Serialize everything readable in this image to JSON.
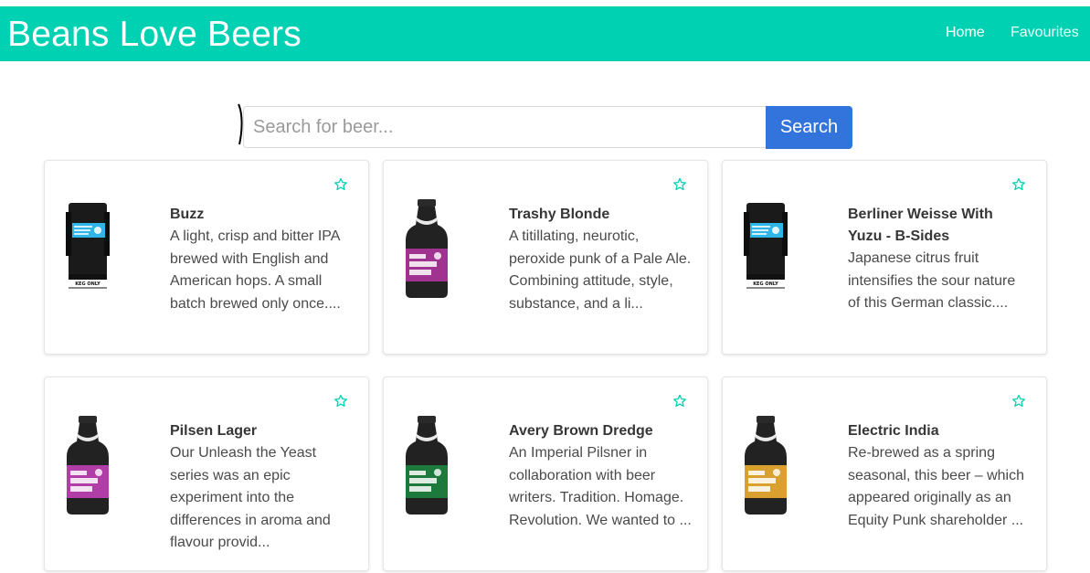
{
  "navbar": {
    "brand": "Beans Love Beers",
    "links": [
      {
        "label": "Home"
      },
      {
        "label": "Favourites"
      }
    ],
    "background": "#00d1b2"
  },
  "search": {
    "placeholder": "Search for beer...",
    "value": "",
    "button_label": "Search",
    "button_color": "#3273dc"
  },
  "beers": [
    {
      "name": "Buzz",
      "description": "A light, crisp and bitter IPA brewed with English and American hops. A small batch brewed only once....",
      "image": "keg",
      "label_color": "#2fb6e8"
    },
    {
      "name": "Trashy Blonde",
      "description": "A titillating, neurotic, peroxide punk of a Pale Ale. Combining attitude, style, substance, and a li...",
      "image": "bottle",
      "label_color": "#a0338f"
    },
    {
      "name": "Berliner Weisse With Yuzu - B-Sides",
      "description": "Japanese citrus fruit intensifies the sour nature of this German classic....",
      "image": "keg",
      "label_color": "#2fb6e8"
    },
    {
      "name": "Pilsen Lager",
      "description": "Our Unleash the Yeast series was an epic experiment into the differences in aroma and flavour provid...",
      "image": "bottle",
      "label_color": "#b03ea6"
    },
    {
      "name": "Avery Brown Dredge",
      "description": "An Imperial Pilsner in collaboration with beer writers. Tradition. Homage. Revolution. We wanted to ...",
      "image": "bottle",
      "label_color": "#1d7a3c"
    },
    {
      "name": "Electric India",
      "description": "Re-brewed as a spring seasonal, this beer – which appeared originally as an Equity Punk shareholder ...",
      "image": "bottle",
      "label_color": "#d9a030"
    }
  ],
  "keg_label": "KEG ONLY",
  "icons": {
    "favourite": "star-outline-icon"
  },
  "accent": "#00d1b2"
}
